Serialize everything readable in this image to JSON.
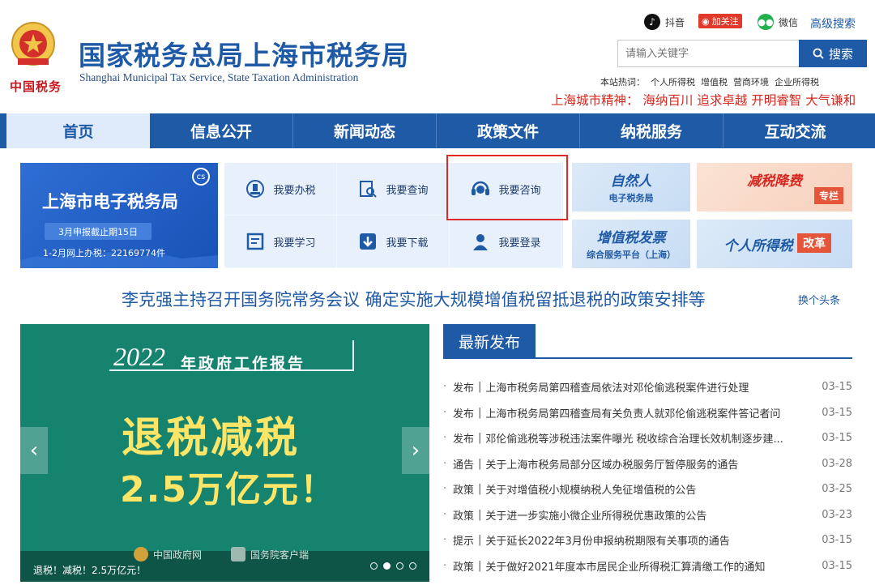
{
  "header": {
    "emblem_text": "中国税务",
    "title": "国家税务总局上海市税务局",
    "subtitle": "Shanghai Municipal Tax Service, State Taxation Administration",
    "social": {
      "douyin": "抖音",
      "weibo_follow": "加关注",
      "wechat": "微信"
    },
    "advanced_search": "高级搜索",
    "search_placeholder": "请输入关键字",
    "search_button": "搜索",
    "hot_label": "本站热词：",
    "hot_words": [
      "个人所得税",
      "增值税",
      "营商环境",
      "企业所得税"
    ],
    "city_spirit": "上海城市精神： 海纳百川 追求卓越 开明睿智 大气谦和"
  },
  "nav": [
    "首页",
    "信息公开",
    "新闻动态",
    "政策文件",
    "纳税服务",
    "互动交流"
  ],
  "etax": {
    "title": "上海市电子税务局",
    "deadline": "3月申报截止期15日",
    "stat": "1-2月网上办税：22169774件",
    "icon": "cs"
  },
  "services": [
    {
      "label": "我要办税",
      "icon": "tax-handle-icon"
    },
    {
      "label": "我要查询",
      "icon": "query-icon"
    },
    {
      "label": "我要咨询",
      "icon": "consult-headset-icon"
    },
    {
      "label": "我要学习",
      "icon": "learn-icon"
    },
    {
      "label": "我要下载",
      "icon": "download-icon"
    },
    {
      "label": "我要登录",
      "icon": "login-user-icon"
    }
  ],
  "promos": [
    {
      "title": "自然人",
      "sub": "电子税务局"
    },
    {
      "title": "增值税发票",
      "sub": "综合服务平台（上海）"
    },
    {
      "title": "减税降费",
      "sub": "专栏"
    },
    {
      "title": "个人所得税",
      "sub": "改革"
    }
  ],
  "headline": "李克强主持召开国务院常务会议 确定实施大规模增值税留抵退税的政策安排等",
  "change_headline": "换个头条",
  "carousel": {
    "year": "2022",
    "year_suffix": "年政府工作报告",
    "main": "退税减税",
    "amount": "2.5万亿元！",
    "logo1": "中国政府网",
    "logo2": "国务院客户端",
    "caption": "退税！减税！2.5万亿元！",
    "active_dot": 1,
    "dot_count": 4
  },
  "news": {
    "heading": "最新发布",
    "items": [
      {
        "cat": "发布",
        "title": "上海市税务局第四稽查局依法对邓伦偷逃税案件进行处理",
        "date": "03-15"
      },
      {
        "cat": "发布",
        "title": "上海市税务局第四稽查局有关负责人就邓伦偷逃税案件答记者问",
        "date": "03-15"
      },
      {
        "cat": "发布",
        "title": "邓伦偷逃税等涉税违法案件曝光 税收综合治理长效机制逐步建...",
        "date": "03-15"
      },
      {
        "cat": "通告",
        "title": "关于上海市税务局部分区域办税服务厅暂停服务的通告",
        "date": "03-28"
      },
      {
        "cat": "政策",
        "title": "关于对增值税小规模纳税人免征增值税的公告",
        "date": "03-25"
      },
      {
        "cat": "政策",
        "title": "关于进一步实施小微企业所得税优惠政策的公告",
        "date": "03-23"
      },
      {
        "cat": "提示",
        "title": "关于延长2022年3月份申报纳税期限有关事项的通告",
        "date": "03-15"
      },
      {
        "cat": "政策",
        "title": "关于做好2021年度本市居民企业所得税汇算清缴工作的通知",
        "date": "03-15"
      }
    ]
  },
  "colors": {
    "brand_blue": "#1f5aa6",
    "red": "#d7281f",
    "carousel_green": "#16836f",
    "highlight": "#e02a25"
  }
}
